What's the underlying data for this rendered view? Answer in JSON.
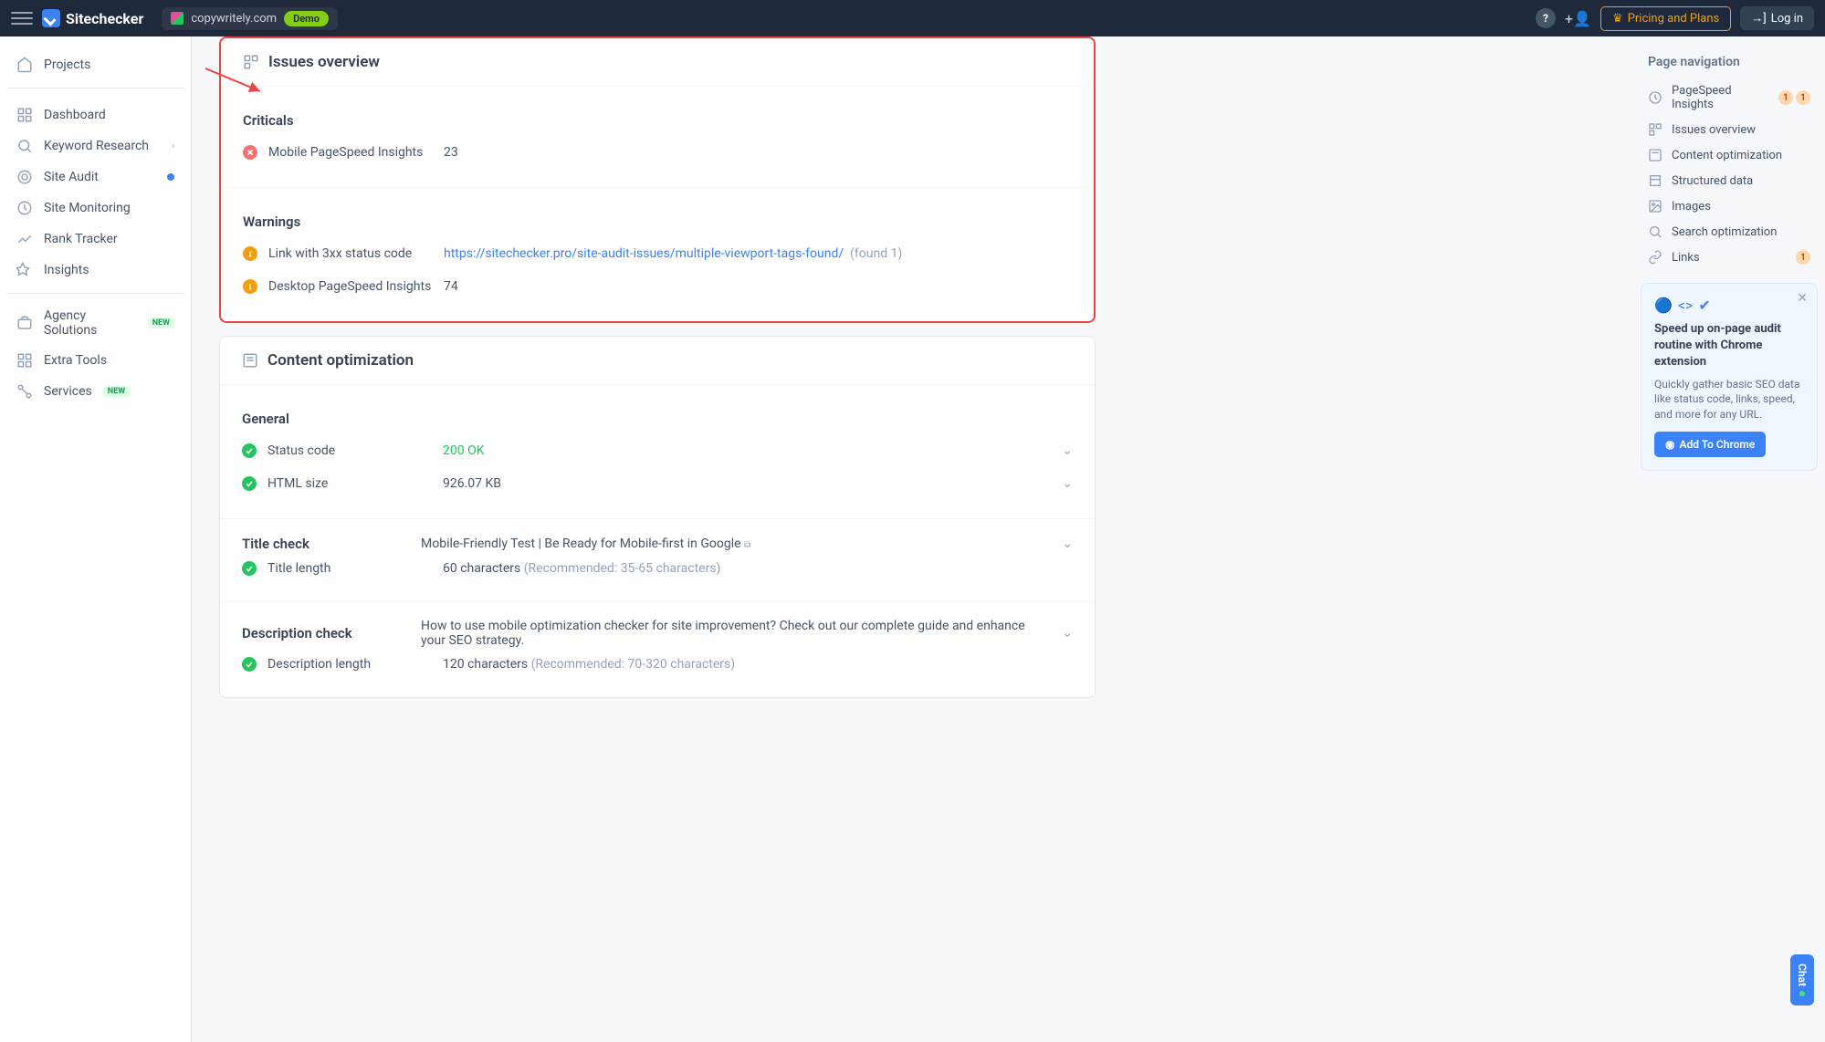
{
  "header": {
    "brand": "Sitechecker",
    "site_name": "copywritely.com",
    "demo_label": "Demo",
    "pricing_label": "Pricing and Plans",
    "login_label": "Log in"
  },
  "sidebar": {
    "projects": "Projects",
    "items": [
      {
        "label": "Dashboard"
      },
      {
        "label": "Keyword Research",
        "chevron": true
      },
      {
        "label": "Site Audit",
        "dot": true
      },
      {
        "label": "Site Monitoring"
      },
      {
        "label": "Rank Tracker"
      },
      {
        "label": "Insights"
      }
    ],
    "extras": [
      {
        "label": "Agency Solutions",
        "new": true
      },
      {
        "label": "Extra Tools"
      },
      {
        "label": "Services",
        "new": true
      }
    ],
    "new_label": "NEW"
  },
  "issues": {
    "title": "Issues overview",
    "criticals_title": "Criticals",
    "criticals": [
      {
        "label": "Mobile PageSpeed Insights",
        "value": "23"
      }
    ],
    "warnings_title": "Warnings",
    "warnings": [
      {
        "label": "Link with 3xx status code",
        "link": "https://sitechecker.pro/site-audit-issues/multiple-viewport-tags-found/",
        "found": "(found 1)"
      },
      {
        "label": "Desktop PageSpeed Insights",
        "value": "74"
      }
    ]
  },
  "content_opt": {
    "title": "Content optimization",
    "general_title": "General",
    "general": [
      {
        "label": "Status code",
        "value": "200 OK",
        "ok_text": true
      },
      {
        "label": "HTML size",
        "value": "926.07 KB"
      }
    ],
    "title_check": {
      "heading": "Title check",
      "value": "Mobile-Friendly Test | Be Ready for Mobile-first in Google",
      "length_label": "Title length",
      "length_value": "60 characters",
      "length_rec": "(Recommended: 35-65 characters)"
    },
    "desc_check": {
      "heading": "Description check",
      "value": "How to use mobile optimization checker for site improvement? Check out our complete guide and enhance your SEO strategy.",
      "length_label": "Description length",
      "length_value": "120 characters",
      "length_rec": "(Recommended: 70-320 characters)"
    }
  },
  "right_nav": {
    "title": "Page navigation",
    "items": [
      {
        "label": "PageSpeed Insights",
        "badges": [
          "1",
          "1"
        ]
      },
      {
        "label": "Issues overview"
      },
      {
        "label": "Content optimization"
      },
      {
        "label": "Structured data"
      },
      {
        "label": "Images"
      },
      {
        "label": "Search optimization"
      },
      {
        "label": "Links",
        "badges": [
          "1"
        ]
      }
    ]
  },
  "promo": {
    "title": "Speed up on-page audit routine with Chrome extension",
    "text": "Quickly gather basic SEO data like status code, links, speed, and more for any URL.",
    "button": "Add To Chrome"
  },
  "chat_label": "Chat"
}
